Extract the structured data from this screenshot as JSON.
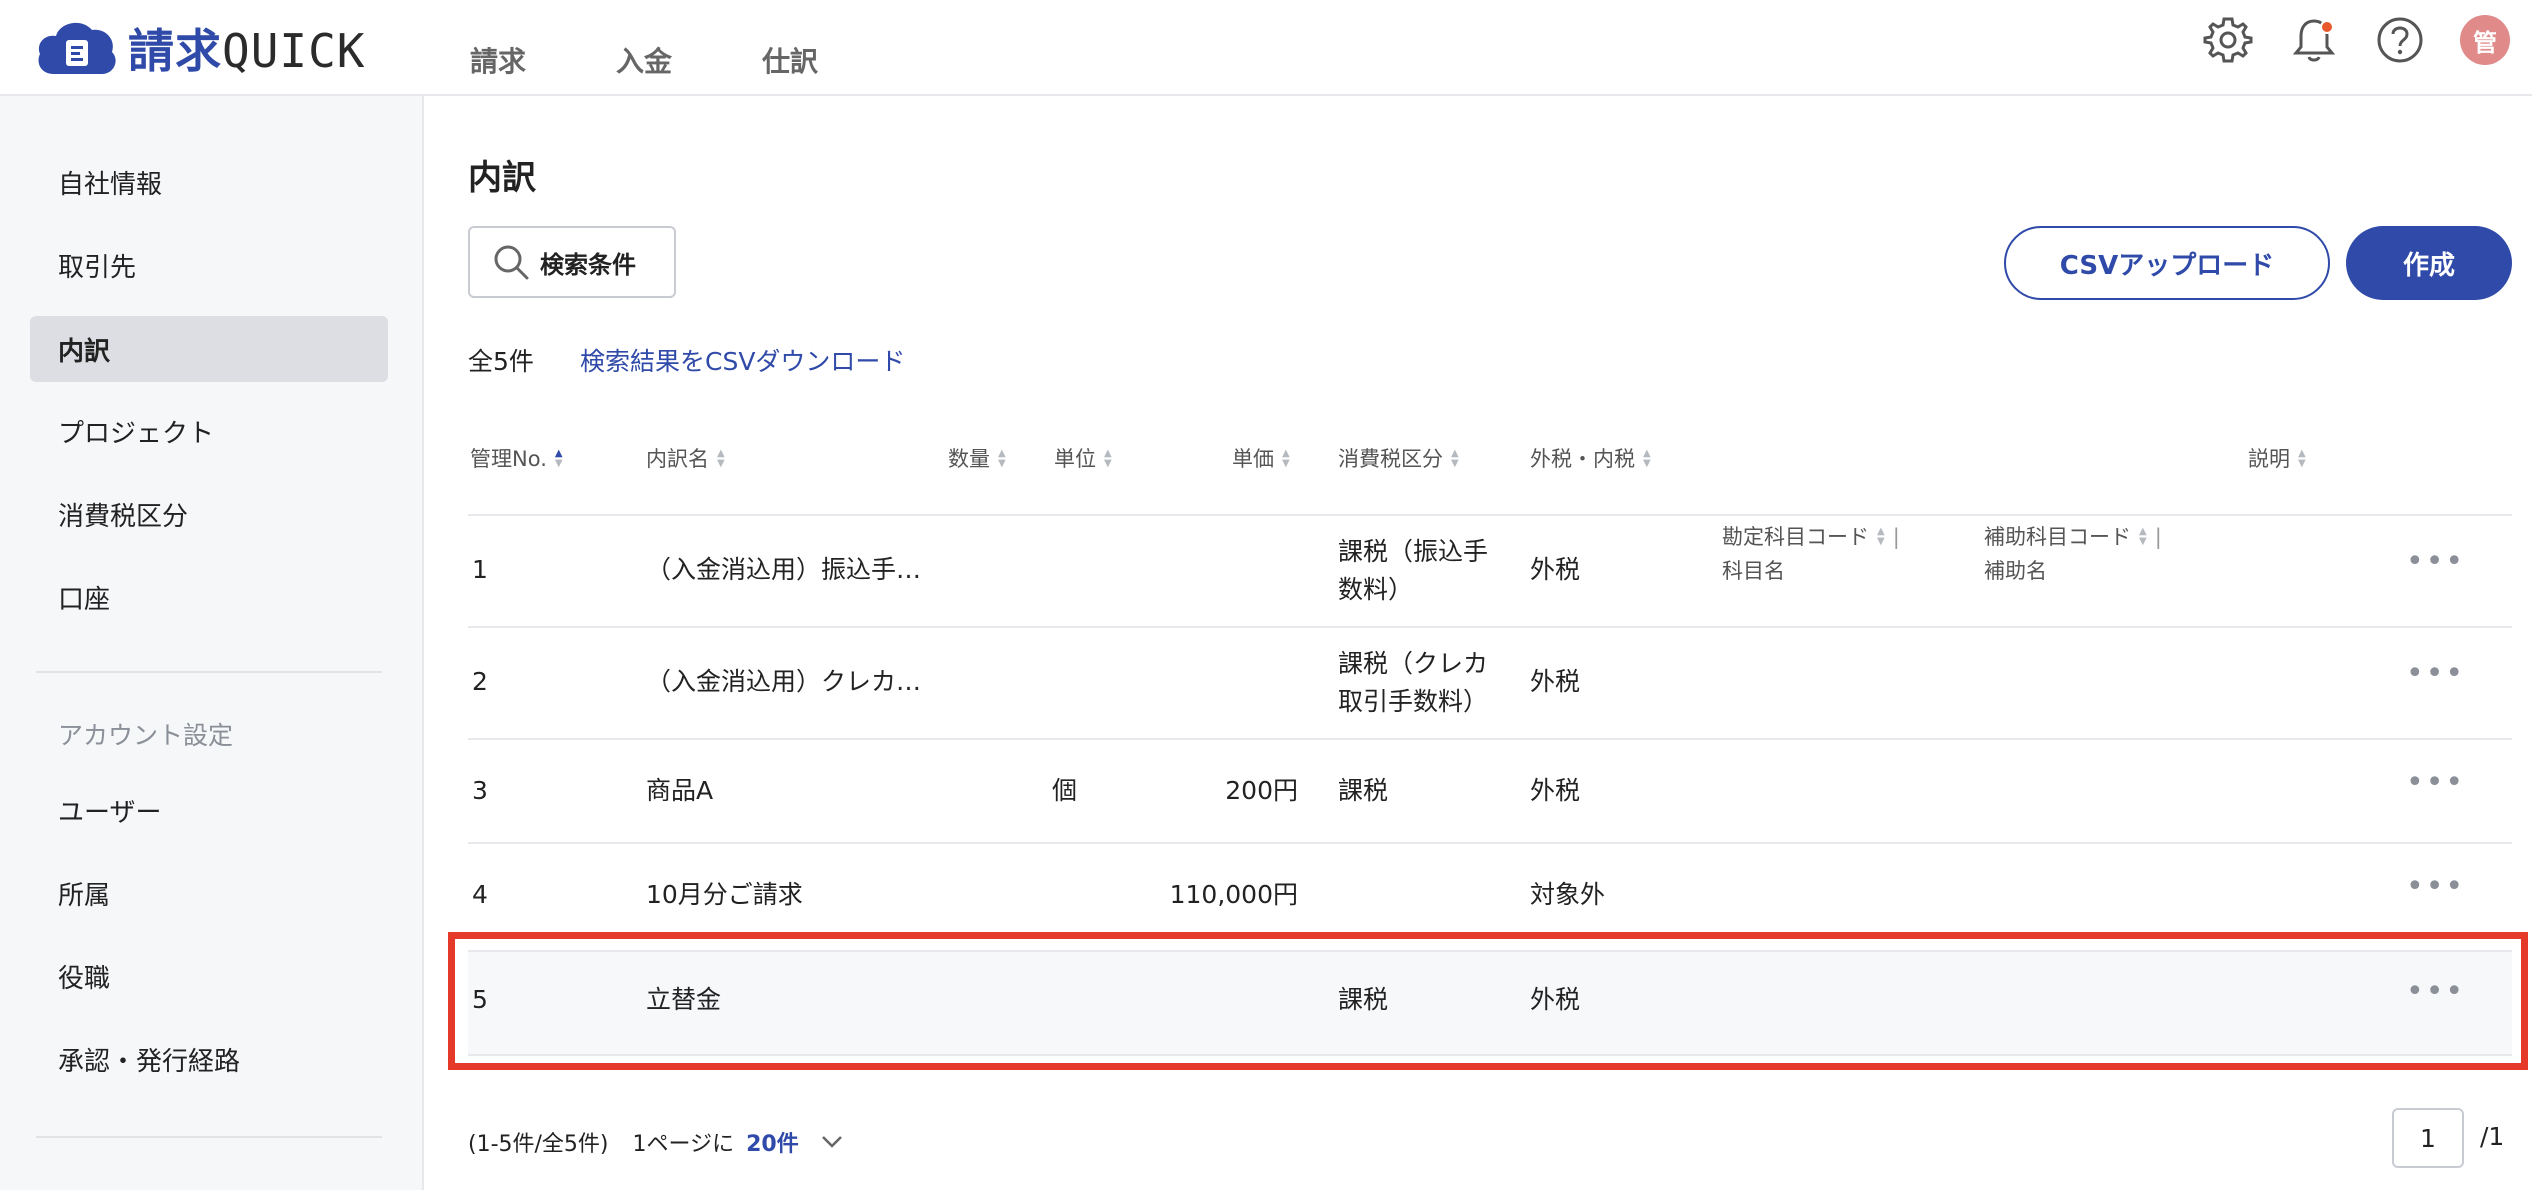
{
  "header": {
    "logo_kanji": "請求",
    "logo_latin": "QUICK",
    "nav": [
      "請求",
      "入金",
      "仕訳"
    ],
    "avatar_text": "管"
  },
  "sidebar": {
    "items": [
      "自社情報",
      "取引先",
      "内訳",
      "プロジェクト",
      "消費税区分",
      "口座"
    ],
    "active_index": 2,
    "account_heading": "アカウント設定",
    "account_items": [
      "ユーザー",
      "所属",
      "役職",
      "承認・発行経路"
    ]
  },
  "main": {
    "title": "内訳",
    "search_label": "検索条件",
    "csv_upload_label": "CSVアップロード",
    "create_label": "作成",
    "count_text": "全5件",
    "csv_download_link": "検索結果をCSVダウンロード"
  },
  "table": {
    "headers": {
      "no": "管理No.",
      "name": "内訳名",
      "qty": "数量",
      "unit": "単位",
      "price": "単価",
      "tax_cat": "消費税区分",
      "tax_mode": "外税・内税",
      "account_1": "勘定科目コード",
      "account_2": "科目名",
      "sub_1": "補助科目コード",
      "sub_2": "補助名",
      "desc": "説明"
    },
    "rows": [
      {
        "no": "1",
        "name": "（入金消込用）振込手…",
        "qty": "",
        "unit": "",
        "price": "",
        "tax_cat_1": "課税（振込手",
        "tax_cat_2": "数料）",
        "tax_mode": "外税"
      },
      {
        "no": "2",
        "name": "（入金消込用）クレカ…",
        "qty": "",
        "unit": "",
        "price": "",
        "tax_cat_1": "課税（クレカ",
        "tax_cat_2": "取引手数料）",
        "tax_mode": "外税"
      },
      {
        "no": "3",
        "name": "商品A",
        "qty": "",
        "unit": "個",
        "price": "200円",
        "tax_cat_1": "課税",
        "tax_cat_2": "",
        "tax_mode": "外税"
      },
      {
        "no": "4",
        "name": "10月分ご請求",
        "qty": "",
        "unit": "",
        "price": "110,000円",
        "tax_cat_1": "",
        "tax_cat_2": "",
        "tax_mode": "対象外"
      },
      {
        "no": "5",
        "name": "立替金",
        "qty": "",
        "unit": "",
        "price": "",
        "tax_cat_1": "課税",
        "tax_cat_2": "",
        "tax_mode": "外税"
      }
    ],
    "more_label": "•••"
  },
  "footer": {
    "range_text": "(1-5件/全5件)",
    "per_page_text": "1ページに",
    "per_page_value": "20件",
    "current_page": "1",
    "total_pages": "/1"
  }
}
